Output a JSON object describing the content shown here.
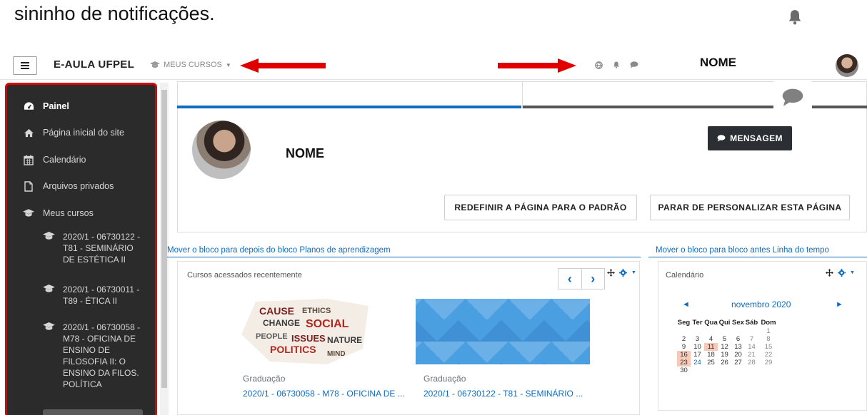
{
  "caption": "sininho de notificações.",
  "navbar": {
    "brand": "E-AULA UFPEL",
    "my_courses": "MEUS CURSOS",
    "user_name": "NOME"
  },
  "sidebar": {
    "items": [
      {
        "label": "Painel",
        "icon": "dashboard-icon"
      },
      {
        "label": "Página inicial do site",
        "icon": "home-icon"
      },
      {
        "label": "Calendário",
        "icon": "calendar-icon"
      },
      {
        "label": "Arquivos privados",
        "icon": "file-icon"
      },
      {
        "label": "Meus cursos",
        "icon": "graduation-cap-icon"
      }
    ],
    "courses": [
      "2020/1 - 06730122 - T81 - SEMINÁRIO DE ESTÉTICA II",
      "2020/1 - 06730011 - T89 - ÉTICA II",
      "2020/1 - 06730058 - M78 - OFICINA DE ENSINO DE FILOSOFIA II: O ENSINO DA FILOS. POLÍTICA"
    ]
  },
  "profile": {
    "name": "NOME",
    "message_button": "MENSAGEM",
    "reset_button": "REDEFINIR A PÁGINA PARA O PADRÃO",
    "stop_button": "PARAR DE PERSONALIZAR ESTA PÁGINA"
  },
  "blocks": {
    "move_recent": "Mover o bloco para depois do bloco Planos de aprendizagem",
    "move_calendar": "Mover o bloco para bloco antes Linha do tempo",
    "recent_title": "Cursos acessados recentemente",
    "calendar_title": "Calendário"
  },
  "recent_courses": [
    {
      "category": "Graduação",
      "name": "2020/1 - 06730058 - M78 - OFICINA DE ..."
    },
    {
      "category": "Graduação",
      "name": "2020/1 - 06730122 - T81 - SEMINÁRIO ..."
    }
  ],
  "calendar": {
    "month": "novembro 2020",
    "weekdays": [
      "Seg",
      "Ter",
      "Qua",
      "Qui",
      "Sex",
      "Sáb",
      "Dom"
    ],
    "weeks": [
      [
        "",
        "",
        "",
        "",
        "",
        "",
        "1"
      ],
      [
        "2",
        "3",
        "4",
        "5",
        "6",
        "7",
        "8"
      ],
      [
        "9",
        "10",
        "11",
        "12",
        "13",
        "14",
        "15"
      ],
      [
        "16",
        "17",
        "18",
        "19",
        "20",
        "21",
        "22"
      ],
      [
        "23",
        "24",
        "25",
        "26",
        "27",
        "28",
        "29"
      ],
      [
        "30",
        "",
        "",
        "",
        "",
        "",
        ""
      ]
    ],
    "today": "11",
    "event_days": [
      "16",
      "23"
    ],
    "linked_days": [
      "24"
    ]
  },
  "colors": {
    "accent": "#0f6cbf",
    "sidebar_bg": "#2b2b2b",
    "annotation_red": "#e00000",
    "highlight": "#f6c9b8"
  }
}
